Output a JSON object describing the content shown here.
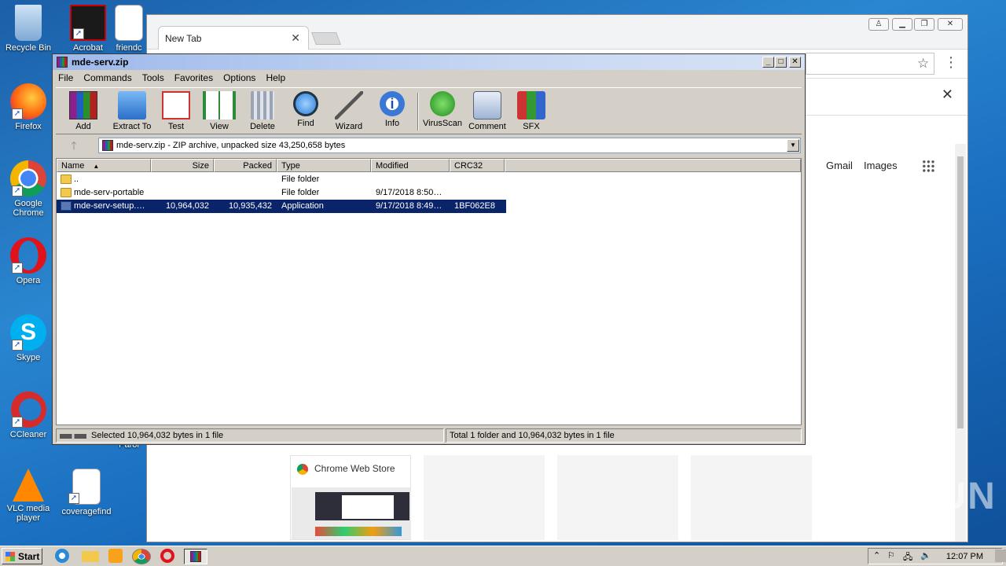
{
  "desktop": {
    "icons": [
      {
        "label": "Recycle Bin"
      },
      {
        "label": "Acrobat"
      },
      {
        "label": "friendc"
      },
      {
        "label": "Firefox"
      },
      {
        "label": "Google Chrome"
      },
      {
        "label": "Opera"
      },
      {
        "label": "Skype"
      },
      {
        "label": "CCleaner"
      },
      {
        "label": "VLC media player"
      },
      {
        "label": "coveragefind"
      },
      {
        "label": "Parol"
      }
    ]
  },
  "chrome": {
    "tab_title": "New Tab",
    "links": {
      "gmail": "Gmail",
      "images": "Images"
    },
    "tile_title": "Chrome Web Store"
  },
  "winrar": {
    "title": "mde-serv.zip",
    "menu": [
      "File",
      "Commands",
      "Tools",
      "Favorites",
      "Options",
      "Help"
    ],
    "toolbar": [
      "Add",
      "Extract To",
      "Test",
      "View",
      "Delete",
      "Find",
      "Wizard",
      "Info",
      "VirusScan",
      "Comment",
      "SFX"
    ],
    "path": "mde-serv.zip - ZIP archive, unpacked size 43,250,658 bytes",
    "columns": [
      "Name",
      "Size",
      "Packed",
      "Type",
      "Modified",
      "CRC32"
    ],
    "rows": [
      {
        "name": "..",
        "size": "",
        "packed": "",
        "type": "File folder",
        "modified": "",
        "crc": "",
        "icon": "folder"
      },
      {
        "name": "mde-serv-portable",
        "size": "",
        "packed": "",
        "type": "File folder",
        "modified": "9/17/2018 8:50…",
        "crc": "",
        "icon": "folder"
      },
      {
        "name": "mde-serv-setup.…",
        "size": "10,964,032",
        "packed": "10,935,432",
        "type": "Application",
        "modified": "9/17/2018 8:49…",
        "crc": "1BF062E8",
        "icon": "app"
      }
    ],
    "status_left": "Selected 10,964,032 bytes in 1 file",
    "status_right": "Total 1 folder and 10,964,032 bytes in 1 file"
  },
  "taskbar": {
    "start": "Start",
    "clock": "12:07 PM"
  },
  "watermark": "ANY RUN"
}
